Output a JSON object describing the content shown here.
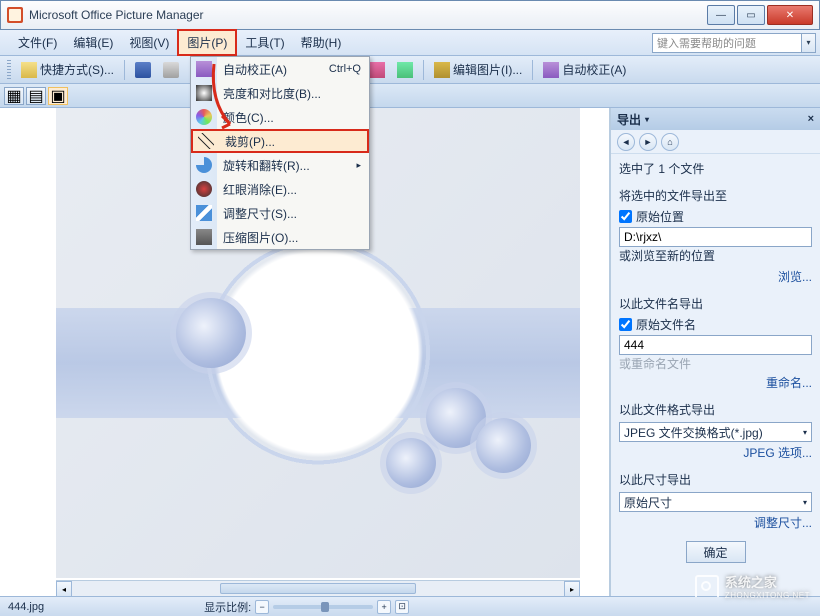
{
  "window": {
    "title": "Microsoft Office Picture Manager"
  },
  "menubar": {
    "file": "文件(F)",
    "edit": "编辑(E)",
    "view": "视图(V)",
    "picture": "图片(P)",
    "tools": "工具(T)",
    "help": "帮助(H)",
    "help_placeholder": "键入需要帮助的问题"
  },
  "toolbar": {
    "shortcut": "快捷方式(S)...",
    "zoom_value": "%",
    "edit_picture": "编辑图片(I)...",
    "auto_correct": "自动校正(A)"
  },
  "dropdown": {
    "auto_correct": "自动校正(A)",
    "auto_correct_key": "Ctrl+Q",
    "brightness": "亮度和对比度(B)...",
    "color": "颜色(C)...",
    "crop": "裁剪(P)...",
    "rotate": "旋转和翻转(R)...",
    "redeye": "红眼消除(E)...",
    "resize": "调整尺寸(S)...",
    "compress": "压缩图片(O)..."
  },
  "taskpane": {
    "title": "导出",
    "selected": "选中了 1 个文件",
    "export_to": "将选中的文件导出至",
    "orig_location": "原始位置",
    "path_value": "D:\\rjxz\\",
    "or_browse": "或浏览至新的位置",
    "browse_link": "浏览...",
    "export_name": "以此文件名导出",
    "orig_filename": "原始文件名",
    "filename_value": "444",
    "or_rename": "或重命名文件",
    "rename_link": "重命名...",
    "export_format": "以此文件格式导出",
    "format_value": "JPEG 文件交换格式(*.jpg)",
    "jpeg_options": "JPEG 选项...",
    "export_size": "以此尺寸导出",
    "size_value": "原始尺寸",
    "resize_link": "调整尺寸...",
    "ok": "确定"
  },
  "statusbar": {
    "filename": "444.jpg",
    "zoom_label": "显示比例:"
  },
  "watermark": {
    "line1": "系统之家",
    "line2": "ZHONGXITONG.NET"
  }
}
